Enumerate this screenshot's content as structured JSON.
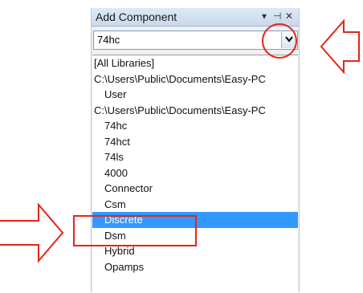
{
  "panel": {
    "title": "Add Component",
    "controls": {
      "dropdown": "▾",
      "pin": "⊣",
      "close": "✕"
    }
  },
  "combo": {
    "value": "74hc",
    "arrow": "⌄"
  },
  "list": {
    "items": [
      {
        "label": "[All Libraries]",
        "level": 0
      },
      {
        "label": "C:\\Users\\Public\\Documents\\Easy-PC",
        "level": 0
      },
      {
        "label": "User",
        "level": 1
      },
      {
        "label": "C:\\Users\\Public\\Documents\\Easy-PC",
        "level": 0
      },
      {
        "label": "74hc",
        "level": 1
      },
      {
        "label": "74hct",
        "level": 1
      },
      {
        "label": "74ls",
        "level": 1
      },
      {
        "label": "4000",
        "level": 1
      },
      {
        "label": "Connector",
        "level": 1
      },
      {
        "label": "Csm",
        "level": 1
      },
      {
        "label": "Discrete",
        "level": 1,
        "selected": true
      },
      {
        "label": "Dsm",
        "level": 1
      },
      {
        "label": "Hybrid",
        "level": 1
      },
      {
        "label": "Opamps",
        "level": 1
      }
    ]
  },
  "annotations": {
    "color": "#e32619"
  },
  "colors": {
    "selection": "#3399ff"
  }
}
